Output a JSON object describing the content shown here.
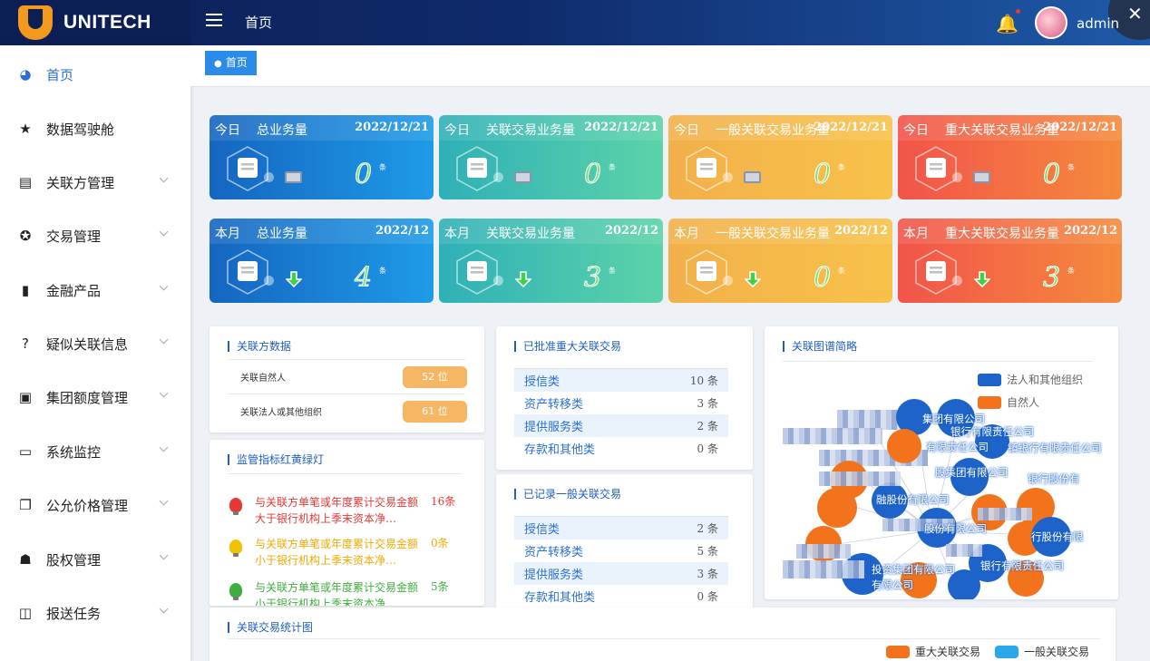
{
  "app": {
    "brand": "UNITECH",
    "top_title": "首页",
    "username": "admin"
  },
  "breadcrumb": "首页",
  "sidebar": {
    "items": [
      {
        "label": "首页",
        "icon": "dashboard-icon"
      },
      {
        "label": "数据驾驶舱",
        "icon": "star-icon"
      },
      {
        "label": "关联方管理",
        "icon": "id-card-icon"
      },
      {
        "label": "交易管理",
        "icon": "life-ring-icon"
      },
      {
        "label": "金融产品",
        "icon": "bar-chart-icon"
      },
      {
        "label": "疑似关联信息",
        "icon": "question-circle-icon"
      },
      {
        "label": "集团额度管理",
        "icon": "image-icon"
      },
      {
        "label": "系统监控",
        "icon": "monitor-icon"
      },
      {
        "label": "公允价格管理",
        "icon": "copy-icon"
      },
      {
        "label": "股权管理",
        "icon": "org-chart-icon"
      },
      {
        "label": "报送任务",
        "icon": "book-icon"
      }
    ]
  },
  "cards": [
    {
      "period": "今日",
      "name": "总业务量",
      "date": "2022/12/21",
      "count": "0",
      "unit": "条",
      "theme": "blue"
    },
    {
      "period": "今日",
      "name": "关联交易业务量",
      "date": "2022/12/21",
      "count": "0",
      "unit": "条",
      "theme": "teal"
    },
    {
      "period": "今日",
      "name": "一般关联交易业务量",
      "date": "2022/12/21",
      "count": "0",
      "unit": "条",
      "theme": "orange"
    },
    {
      "period": "今日",
      "name": "重大关联交易业务量",
      "date": "2022/12/21",
      "count": "0",
      "unit": "条",
      "theme": "red"
    },
    {
      "period": "本月",
      "name": "总业务量",
      "date": "2022/12",
      "count": "4",
      "unit": "条",
      "theme": "blue"
    },
    {
      "period": "本月",
      "name": "关联交易业务量",
      "date": "2022/12",
      "count": "3",
      "unit": "条",
      "theme": "teal"
    },
    {
      "period": "本月",
      "name": "一般关联交易业务量",
      "date": "2022/12",
      "count": "0",
      "unit": "条",
      "theme": "orange"
    },
    {
      "period": "本月",
      "name": "重大关联交易业务量",
      "date": "2022/12",
      "count": "3",
      "unit": "条",
      "theme": "red"
    }
  ],
  "related_party": {
    "title": "关联方数据",
    "rows": [
      {
        "label": "关联自然人",
        "value": "52 位"
      },
      {
        "label": "关联法人或其他组织",
        "value": "61 位"
      }
    ]
  },
  "traffic_lights": {
    "title": "监管指标红黄绿灯",
    "rows": [
      {
        "text": "与关联方单笔或年度累计交易金额大于银行机构上季末资本净…",
        "value": "16条",
        "color": "#e53935"
      },
      {
        "text": "与关联方单笔或年度累计交易金额小于银行机构上季末资本净…",
        "value": "0条",
        "color": "#f2a900"
      },
      {
        "text": "与关联方单笔或年度累计交易金额小于银行机构上季末资本净…",
        "value": "5条",
        "color": "#3fae3f"
      }
    ]
  },
  "major_tx": {
    "title": "已批准重大关联交易",
    "rows": [
      {
        "label": "授信类",
        "value": "10 条"
      },
      {
        "label": "资产转移类",
        "value": "3 条"
      },
      {
        "label": "提供服务类",
        "value": "2 条"
      },
      {
        "label": "存款和其他类",
        "value": "0 条"
      }
    ]
  },
  "general_tx": {
    "title": "已记录一般关联交易",
    "rows": [
      {
        "label": "授信类",
        "value": "2 条"
      },
      {
        "label": "资产转移类",
        "value": "5 条"
      },
      {
        "label": "提供服务类",
        "value": "3 条"
      },
      {
        "label": "存款和其他类",
        "value": "0 条"
      }
    ]
  },
  "graph": {
    "title": "关联图谱简略",
    "legend": [
      {
        "label": "法人和其他组织",
        "color": "#1d63c9"
      },
      {
        "label": "自然人",
        "color": "#f2731c"
      }
    ],
    "labels": [
      "集团有限公司",
      "银行有限责任公司",
      "有限责任公司",
      "镇银行有限责任公司",
      "股集团有限公司",
      "银行股份有",
      "融股份有限公司",
      "股份有限公司",
      "行股份有限",
      "投资集团有限公司",
      "银行有限责任公司",
      "有限公司"
    ]
  },
  "stats": {
    "title": "关联交易统计图",
    "legend": [
      {
        "label": "重大关联交易",
        "color": "#f2731c"
      },
      {
        "label": "一般关联交易",
        "color": "#2aa7e8"
      }
    ]
  }
}
